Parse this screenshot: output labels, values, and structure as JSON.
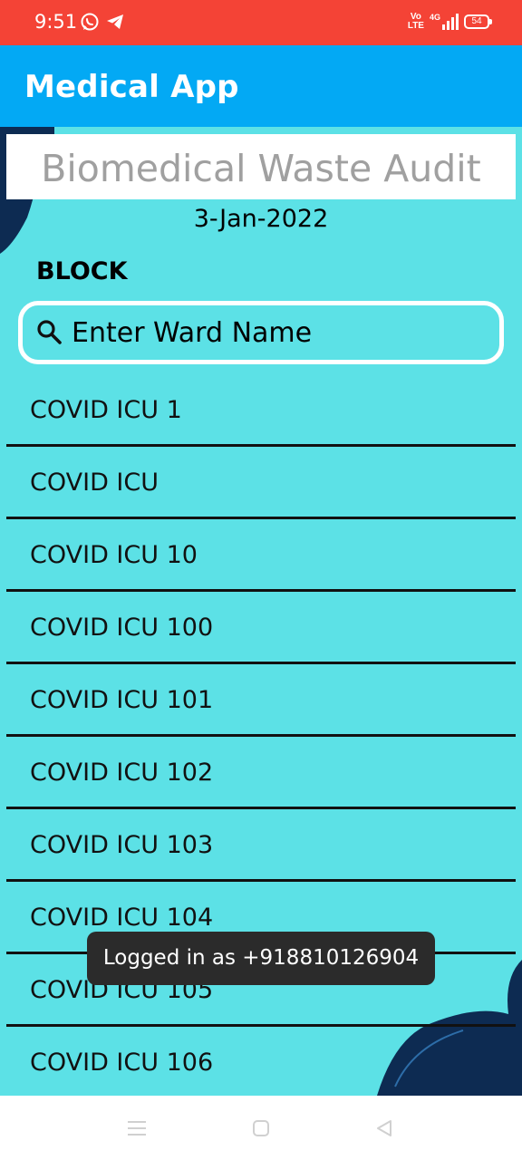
{
  "status_bar": {
    "time": "9:51",
    "network_top": "Vo",
    "network_bottom": "LTE",
    "network_type": "4G",
    "battery": "54",
    "background": "#f44336"
  },
  "app_bar": {
    "title": "Medical App",
    "background": "#03a9f4"
  },
  "header": {
    "title": "Biomedical Waste Audit",
    "date": "3-Jan-2022"
  },
  "block_label": "BLOCK",
  "search": {
    "placeholder": "Enter Ward Name",
    "value": ""
  },
  "wards": [
    {
      "label": "COVID ICU 1"
    },
    {
      "label": "COVID ICU"
    },
    {
      "label": "COVID ICU 10"
    },
    {
      "label": "COVID ICU 100"
    },
    {
      "label": "COVID ICU 101"
    },
    {
      "label": "COVID ICU 102"
    },
    {
      "label": "COVID ICU 103"
    },
    {
      "label": "COVID ICU 104"
    },
    {
      "label": "COVID ICU 105"
    },
    {
      "label": "COVID ICU 106"
    }
  ],
  "toast": {
    "message": "Logged in as +918810126904"
  },
  "colors": {
    "content_background": "#5ce1e6",
    "decoration": "#0d2b52"
  },
  "icons": {
    "status": [
      "whatsapp-icon",
      "telegram-icon",
      "signal-icon",
      "battery-icon"
    ],
    "search": "search-icon",
    "nav": [
      "menu-icon",
      "home-icon",
      "back-icon"
    ]
  }
}
